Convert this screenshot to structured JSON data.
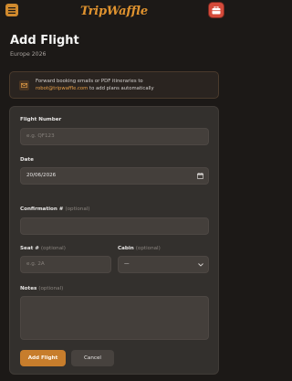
{
  "header": {
    "logo_text": "TripWaffle",
    "menu_icon": "hamburger-icon",
    "profile_icon": "suitcase-icon"
  },
  "page": {
    "title": "Add Flight",
    "subtitle": "Europe 2026"
  },
  "info_banner": {
    "icon": "mail-icon",
    "text_before": "Forward booking emails or PDF itineraries to",
    "email": "robot@tripwaffle.com",
    "text_after": "to add plans automatically"
  },
  "form": {
    "flight_number": {
      "label": "Flight Number",
      "value": "",
      "placeholder": "e.g. QF123"
    },
    "date": {
      "label": "Date",
      "value": "20/06/2026",
      "icon": "calendar-icon"
    },
    "confirmation": {
      "label": "Confirmation #",
      "optional": "(optional)",
      "value": ""
    },
    "seat": {
      "label": "Seat #",
      "optional": "(optional)",
      "value": "",
      "placeholder": "e.g. 2A"
    },
    "cabin": {
      "label": "Cabin",
      "optional": "(optional)",
      "selected": "—",
      "icon": "chevron-down-icon"
    },
    "notes": {
      "label": "Notes",
      "optional": "(optional)",
      "value": ""
    }
  },
  "actions": {
    "submit_label": "Add Flight",
    "cancel_label": "Cancel"
  },
  "colors": {
    "background": "#1c1917",
    "card": "#33302d",
    "accent": "#c77d2c",
    "logo": "#e0932f",
    "profile": "#d44a3a"
  }
}
